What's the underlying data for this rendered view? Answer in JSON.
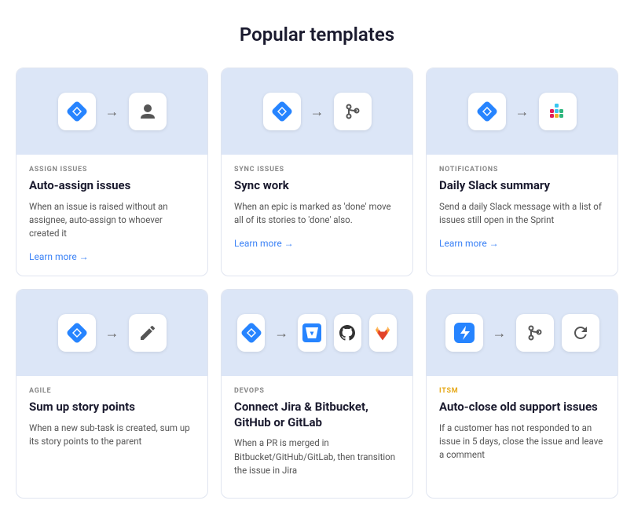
{
  "page": {
    "title": "Popular templates"
  },
  "cards": [
    {
      "id": "auto-assign",
      "category": "ASSIGN ISSUES",
      "title": "Auto-assign issues",
      "description": "When an issue is raised without an assignee, auto-assign to whoever created it",
      "learn_more": "Learn more →",
      "icon_left": "jira",
      "icon_right": "person"
    },
    {
      "id": "sync-work",
      "category": "SYNC ISSUES",
      "title": "Sync work",
      "description": "When an epic is marked as 'done' move all of its stories to 'done' also.",
      "learn_more": "Learn more →",
      "icon_left": "jira",
      "icon_right": "branch"
    },
    {
      "id": "daily-slack",
      "category": "NOTIFICATIONS",
      "title": "Daily Slack summary",
      "description": "Send a daily Slack message with a list of issues still open in the Sprint",
      "learn_more": "Learn more →",
      "icon_left": "jira",
      "icon_right": "slack"
    },
    {
      "id": "sum-story",
      "category": "AGILE",
      "title": "Sum up story points",
      "description": "When a new sub-task is created, sum up its story points to the parent",
      "learn_more": null,
      "icon_left": "jira",
      "icon_right": "pen"
    },
    {
      "id": "connect-jira",
      "category": "DEVOPS",
      "title": "Connect Jira & Bitbucket, GitHub or GitLab",
      "description": "When a PR is merged in Bitbucket/GitHub/GitLab, then transition the issue in Jira",
      "learn_more": null,
      "icon_left": "jira",
      "icon_right": "multi-devops"
    },
    {
      "id": "auto-close",
      "category": "ITSM",
      "title": "Auto-close old support issues",
      "description": "If a customer has not responded to an issue in 5 days, close the issue and leave a comment",
      "learn_more": null,
      "icon_left": "bolt",
      "icon_right": "multi-itsm"
    }
  ],
  "colors": {
    "category_assign": "#888",
    "category_devops": "#888",
    "category_itsm": "#e6a817"
  }
}
